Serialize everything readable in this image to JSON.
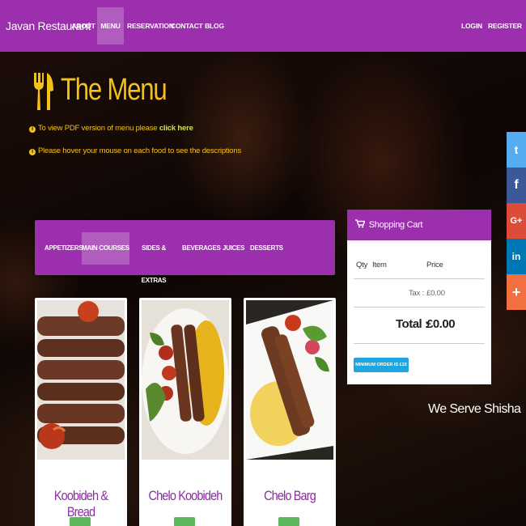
{
  "navbar": {
    "brand": "Javan Restaurant",
    "items": [
      "ABOUT",
      "MENU",
      "RESERVATION",
      "CONTACT",
      "BLOG"
    ],
    "active": "MENU",
    "right_items": [
      "LOGIN",
      "REGISTER"
    ],
    "color": "#9b2fae"
  },
  "header": {
    "title": "The Menu",
    "info1_text": "To view PDF version of menu please",
    "info1_link": "click here",
    "info2_text": "Please hover your mouse on each food to see the descriptions",
    "icon": "fork-knife-icon",
    "color": "#f2c21b"
  },
  "categories": {
    "items": [
      "APPETIZERS",
      "MAIN COURSES",
      "SIDES & EXTRAS",
      "BEVERAGES",
      "JUICES",
      "DESSERTS"
    ],
    "active": "MAIN COURSES"
  },
  "cart": {
    "title": "Shopping Cart",
    "col_qty": "Qty",
    "col_item": "Item",
    "col_price": "Price",
    "tax_label": "Tax :",
    "tax_value": "£0.00",
    "total_label": "Total :",
    "total_value": "£0.00",
    "min_order": "MINIMUM ORDER IS £15",
    "button_color": "#1ea6e0"
  },
  "social": {
    "icons": [
      "twitter-icon",
      "facebook-icon",
      "google-plus-icon",
      "linkedin-icon",
      "share-plus-icon"
    ],
    "labels": [
      "t",
      "f",
      "G+",
      "in",
      "+"
    ],
    "colors": [
      "#55acee",
      "#3b5998",
      "#dd4b39",
      "#0077b5",
      "#f26f3f"
    ]
  },
  "shisha": "We Serve Shisha",
  "foods": [
    {
      "name": "Koobideh & Bread"
    },
    {
      "name": "Chelo Koobideh"
    },
    {
      "name": "Chelo Barg"
    }
  ]
}
